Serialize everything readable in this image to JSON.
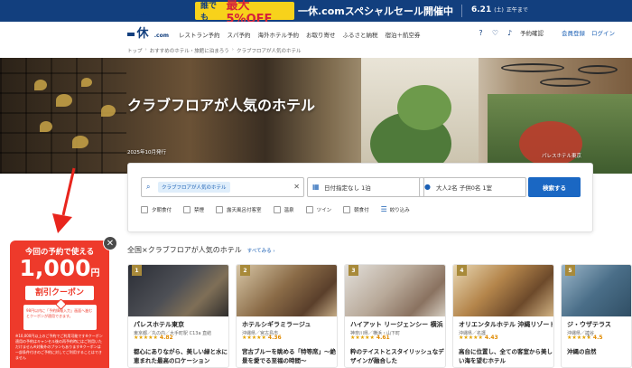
{
  "banner": {
    "badge_pre": "誰でも",
    "badge_main": "最大5%OFF",
    "sale_text": "一休.comスペシャルセール開催中",
    "date": "6.21",
    "date_day": "(土)",
    "date_suffix": "正午まで"
  },
  "header": {
    "logo": "一休",
    "logo_suffix": ".com",
    "nav": [
      "レストラン予約",
      "スパ予約",
      "海外ホテル予約",
      "お取り寄せ",
      "ふるさと納税",
      "宿泊＋航空券"
    ],
    "reservation_label": "予約確認",
    "register_label": "会員登録",
    "login_label": "ログイン"
  },
  "breadcrumb": [
    "トップ",
    "おすすめのホテル・旅館に泊まろう",
    "クラブフロアが人気のホテル"
  ],
  "hero": {
    "title": "クラブフロアが人気のホテル",
    "date": "2025年10月発行",
    "credit": "パレスホテル東京"
  },
  "search": {
    "keyword_chip": "クラブフロアが人気のホテル",
    "date_text": "日付指定なし 1泊",
    "guest_text": "大人2名 子供0名 1室",
    "search_button": "検索する",
    "filters": [
      "夕朝食付",
      "禁煙",
      "露天風呂付客室",
      "温泉",
      "ツイン",
      "朝食付"
    ],
    "narrow_label": "絞り込み"
  },
  "section": {
    "title": "全国×クラブフロアが人気のホテル",
    "see_all": "すべてみる"
  },
  "cards": [
    {
      "rank": "1",
      "name": "パレスホテル東京",
      "loc": "東京都／丸の内／大手町駅 C13a 直結",
      "rating": "4.82",
      "desc": "都心にありながら、美しい緑と水に恵まれた最高のロケーション"
    },
    {
      "rank": "2",
      "name": "ホテルシギラミラージュ",
      "loc": "沖縄県／宮古島市",
      "rating": "4.36",
      "desc": "宮古ブルーを眺める「特等席」〜絶景を愛でる至福の時間〜"
    },
    {
      "rank": "3",
      "name": "ハイアット リージェンシー 横浜",
      "loc": "神奈川県／横浜・山下町",
      "rating": "4.61",
      "desc": "粋のテイストとスタイリッシュなデザインが融合した"
    },
    {
      "rank": "4",
      "name": "オリエンタルホテル 沖縄リゾート＆スパ",
      "loc": "沖縄県／名護",
      "rating": "4.43",
      "desc": "高台に位置し、全ての客室から美しい海を望むホテル"
    },
    {
      "rank": "5",
      "name": "ジ・ウザテラス",
      "loc": "沖縄県／読谷",
      "rating": "4.5",
      "desc": "沖縄の自然"
    }
  ],
  "coupon": {
    "headline": "今回の予約で使える",
    "amount": "1,000",
    "unit": "円",
    "label": "割引クーポン",
    "inner_text": "98円以内に「予約情報入力」画面へ進むとクーポンが適用できます。",
    "fine_print": "※10,000円以上のご予約でご利用可能です※クーポン適用の予約はキャンセル後の再予約時にはご利用いただけません※対象外のプランもあります※クーポンは一部条件付きのご予約に対してご利用することはできません",
    "accent": "#ee3a2b"
  },
  "colors": {
    "navy": "#123f7e",
    "yellow": "#f7d21b",
    "search_button": "#1a67c3"
  }
}
